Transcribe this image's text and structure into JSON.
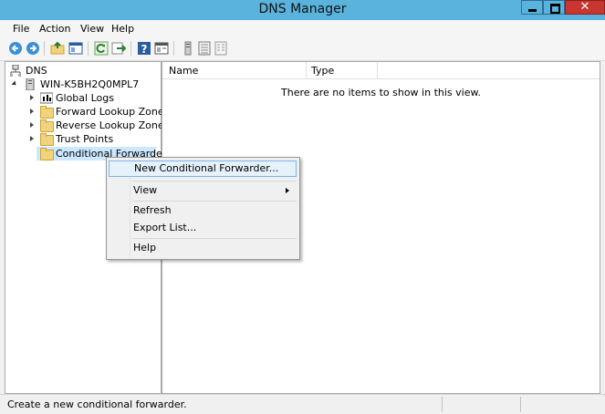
{
  "window": {
    "title": "DNS Manager"
  },
  "menubar": [
    "File",
    "Action",
    "View",
    "Help"
  ],
  "tree": {
    "root": "DNS",
    "server": "WIN-K5BH2Q0MPL7",
    "children": [
      "Global Logs",
      "Forward Lookup Zones",
      "Reverse Lookup Zones",
      "Trust Points",
      "Conditional Forwarders"
    ]
  },
  "list": {
    "columns": [
      "Name",
      "Type"
    ],
    "empty_message": "There are no items to show in this view."
  },
  "context_menu": {
    "items": [
      "New Conditional Forwarder...",
      "View",
      "Refresh",
      "Export List...",
      "Help"
    ]
  },
  "status": {
    "text": "Create a new conditional forwarder."
  },
  "colors": {
    "titlebar": "#5ab3dc",
    "close": "#c7372f",
    "selection": "#cce8ff"
  },
  "icons": {
    "toolbar": [
      "back-icon",
      "forward-icon",
      "up-folder-icon",
      "show-hide-tree-icon",
      "refresh-icon",
      "export-icon",
      "help-icon",
      "properties-icon",
      "server-icon",
      "list-icon",
      "details-icon"
    ]
  }
}
